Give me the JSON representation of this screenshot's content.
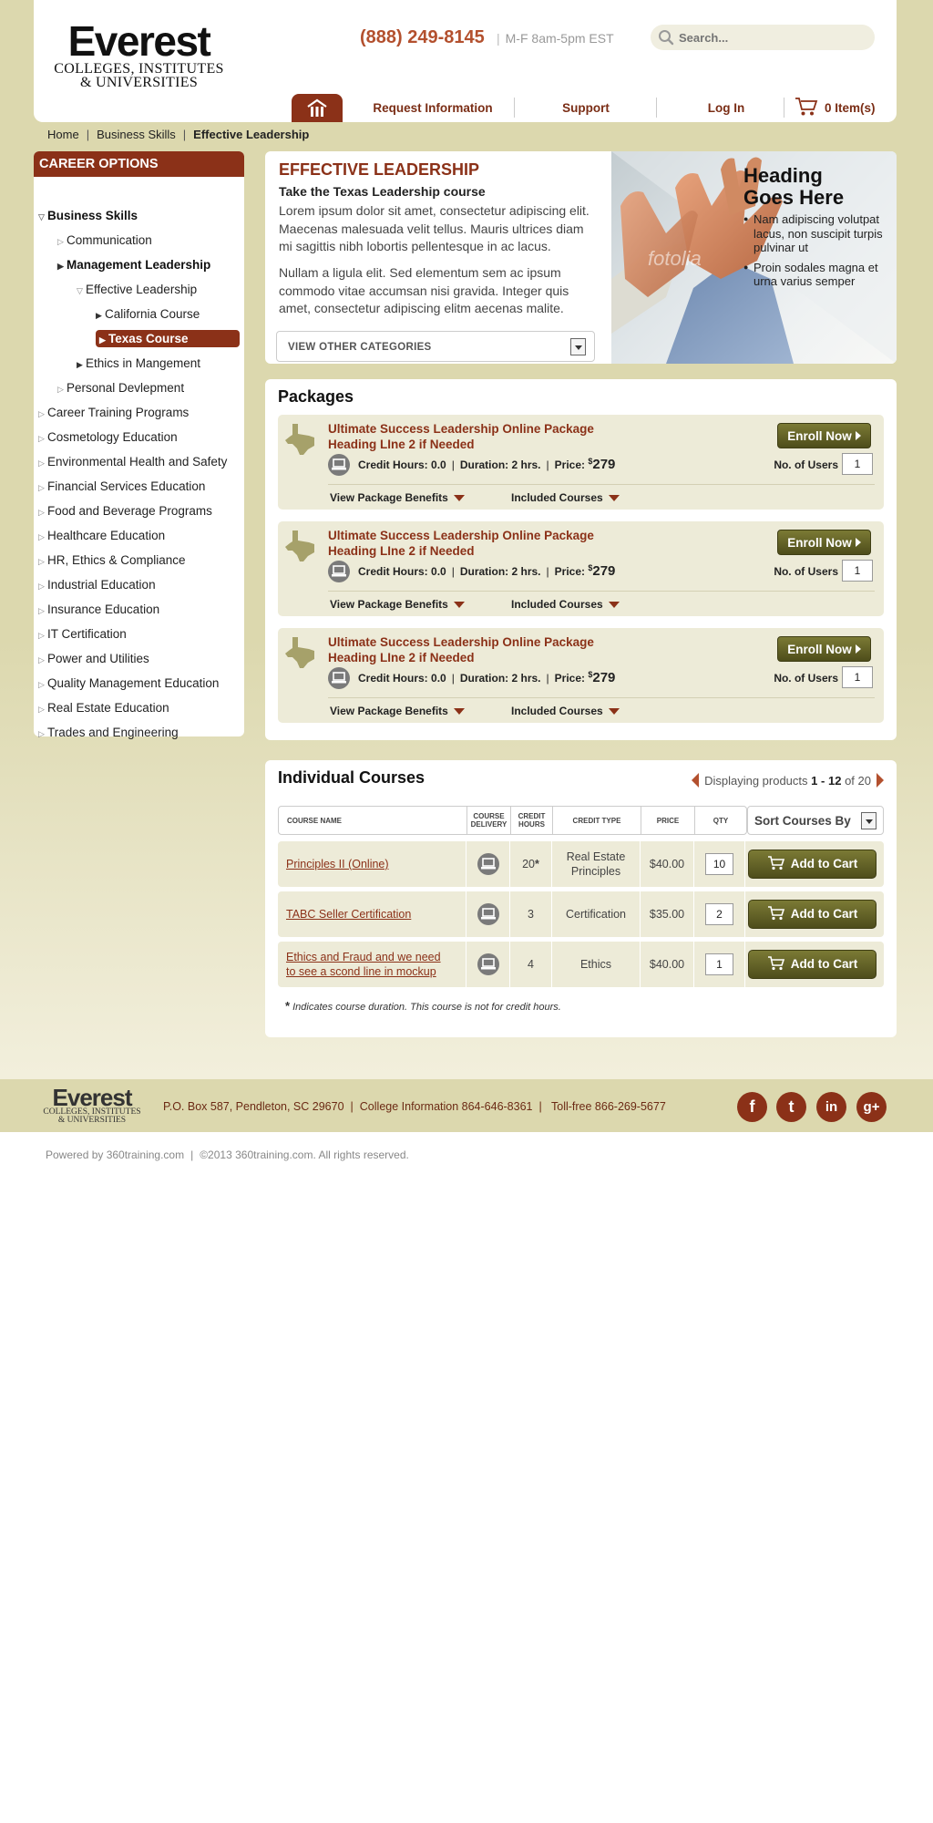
{
  "header": {
    "logo": {
      "name": "Everest",
      "tagline_1": "COLLEGES, INSTITUTES",
      "tagline_2": "& UNIVERSITIES"
    },
    "phone": "(888) 249-8145",
    "hours": "M-F 8am-5pm EST",
    "search_placeholder": "Search...",
    "nav": {
      "request_info": "Request Information",
      "support": "Support",
      "login": "Log In",
      "cart": "0 Item(s)"
    }
  },
  "breadcrumb": [
    "Home",
    "Business Skills",
    "Effective Leadership"
  ],
  "sidebar": {
    "title": "CAREER OPTIONS",
    "items": [
      {
        "label": "Business Skills",
        "level": 0,
        "state": "open",
        "bold": true
      },
      {
        "label": "Communication",
        "level": 1,
        "state": "closed"
      },
      {
        "label": "Management Leadership",
        "level": 1,
        "state": "closed-filled",
        "bold": true
      },
      {
        "label": "Effective Leadership",
        "level": 2,
        "state": "open"
      },
      {
        "label": "California Course",
        "level": 3,
        "state": "closed-filled"
      },
      {
        "label": "Texas Course",
        "level": 3,
        "state": "active"
      },
      {
        "label": "Ethics in Mangement",
        "level": 2,
        "state": "closed-filled"
      },
      {
        "label": "Personal Devlepment",
        "level": 1,
        "state": "closed"
      },
      {
        "label": "Career Training Programs",
        "level": 0,
        "state": "closed"
      },
      {
        "label": "Cosmetology Education",
        "level": 0,
        "state": "closed"
      },
      {
        "label": "Environmental Health and Safety",
        "level": 0,
        "state": "closed"
      },
      {
        "label": "Financial Services Education",
        "level": 0,
        "state": "closed"
      },
      {
        "label": "Food and Beverage Programs",
        "level": 0,
        "state": "closed"
      },
      {
        "label": "Healthcare Education",
        "level": 0,
        "state": "closed"
      },
      {
        "label": "HR, Ethics & Compliance",
        "level": 0,
        "state": "closed"
      },
      {
        "label": "Industrial Education",
        "level": 0,
        "state": "closed"
      },
      {
        "label": "Insurance Education",
        "level": 0,
        "state": "closed"
      },
      {
        "label": "IT Certification",
        "level": 0,
        "state": "closed"
      },
      {
        "label": "Power and Utilities",
        "level": 0,
        "state": "closed"
      },
      {
        "label": "Quality Management Education",
        "level": 0,
        "state": "closed"
      },
      {
        "label": "Real Estate Education",
        "level": 0,
        "state": "closed"
      },
      {
        "label": "Trades and Engineering",
        "level": 0,
        "state": "closed"
      }
    ]
  },
  "intro": {
    "title": "EFFECTIVE LEADERSHIP",
    "subtitle": "Take the Texas Leadership course",
    "p1": "Lorem ipsum dolor sit amet, consectetur adipiscing elit. Maecenas malesuada velit tellus. Mauris ultrices diam mi sagittis nibh lobortis pellentesque in ac lacus.",
    "p2": "Nullam a ligula elit. Sed elementum sem ac ipsum commodo vitae accumsan nisi gravida. Integer quis amet, consectetur adipiscing elitm aecenas malite.",
    "dropdown": "VIEW OTHER CATEGORIES",
    "hero_heading_1": "Heading",
    "hero_heading_2": "Goes Here",
    "hero_bullets": [
      "Nam adipiscing volutpat lacus, non suscipit turpis pulvinar ut",
      "Proin sodales magna et urna varius semper"
    ],
    "hero_watermark": "fotolia"
  },
  "packages": {
    "title": "Packages",
    "enroll_label": "Enroll Now",
    "users_label": "No. of Users",
    "benefits_label": "View Package Benefits",
    "included_label": "Included Courses",
    "credit_label": "Credit Hours:",
    "duration_label": "Duration:",
    "price_label": "Price:",
    "items": [
      {
        "title_1": "Ultimate Success Leadership Online Package",
        "title_2": "Heading LIne 2 if Needed",
        "credit": "0.0",
        "duration": "2 hrs.",
        "currency": "$",
        "price": "279",
        "users": "1"
      },
      {
        "title_1": "Ultimate Success Leadership Online Package",
        "title_2": "Heading LIne 2 if Needed",
        "credit": "0.0",
        "duration": "2 hrs.",
        "currency": "$",
        "price": "279",
        "users": "1"
      },
      {
        "title_1": "Ultimate Success Leadership Online Package",
        "title_2": "Heading LIne 2 if Needed",
        "credit": "0.0",
        "duration": "2 hrs.",
        "currency": "$",
        "price": "279",
        "users": "1"
      }
    ]
  },
  "courses": {
    "title": "Individual Courses",
    "pager": {
      "prefix": "Displaying products",
      "from": "1",
      "dash": "-",
      "to": "12",
      "of": "of 20"
    },
    "columns": {
      "name": "COURSE NAME",
      "delivery_1": "COURSE",
      "delivery_2": "DELIVERY",
      "credit_1": "CREDIT",
      "credit_2": "HOURS",
      "type": "CREDIT TYPE",
      "price": "PRICE",
      "qty": "QTY"
    },
    "sort_label": "Sort Courses By",
    "add_label": "Add to Cart",
    "rows": [
      {
        "name_1": "Principles II (Online)",
        "name_2": "",
        "credit": "20",
        "credit_star": "*",
        "type_1": "Real Estate",
        "type_2": "Principles",
        "price": "$40.00",
        "qty": "10"
      },
      {
        "name_1": "TABC Seller Certification",
        "name_2": "",
        "credit": "3",
        "credit_star": "",
        "type_1": "Certification",
        "type_2": "",
        "price": "$35.00",
        "qty": "2"
      },
      {
        "name_1": "Ethics and Fraud and we need",
        "name_2": "to see a scond line in mockup",
        "credit": "4",
        "credit_star": "",
        "type_1": "Ethics",
        "type_2": "",
        "price": "$40.00",
        "qty": "1"
      }
    ],
    "footnote_star": "*",
    "footnote": "Indicates course duration. This course is not for credit hours."
  },
  "footer": {
    "logo_name": "Everest",
    "logo_tag_1": "COLLEGES, INSTITUTES",
    "logo_tag_2": "& UNIVERSITIES",
    "address": "P.O. Box 587, Pendleton, SC 29670",
    "college_info": "College Information 864-646-8361",
    "tollfree": "Toll-free 866-269-5677",
    "social": {
      "facebook": "f",
      "twitter": "t",
      "linkedin": "in",
      "gplus": "g+"
    },
    "powered": "Powered by 360training.com",
    "copyright": "©2013 360training.com. All rights reserved."
  },
  "colors": {
    "brand": "#8b3118",
    "olive": "#5e5d24",
    "panel_bg": "#edebd8",
    "page_bg": "#dcd8ae"
  }
}
